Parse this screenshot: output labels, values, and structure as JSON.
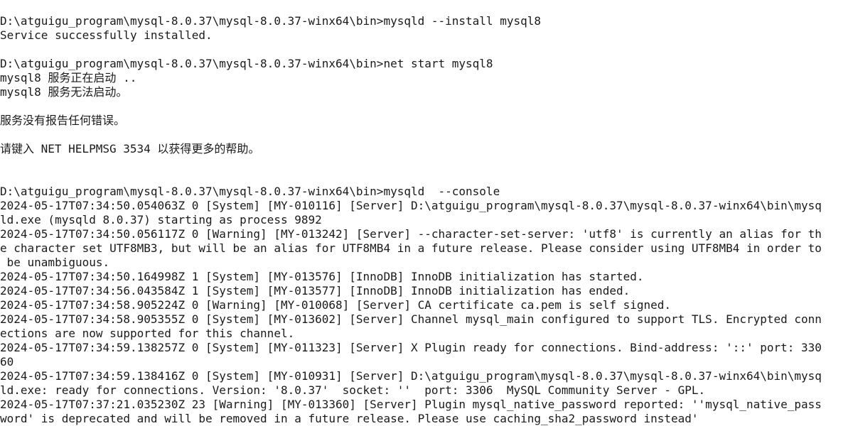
{
  "console": {
    "lines": [
      "D:\\atguigu_program\\mysql-8.0.37\\mysql-8.0.37-winx64\\bin>mysqld --install mysql8",
      "Service successfully installed.",
      "",
      "D:\\atguigu_program\\mysql-8.0.37\\mysql-8.0.37-winx64\\bin>net start mysql8",
      "mysql8 服务正在启动 ..",
      "mysql8 服务无法启动。",
      "",
      "服务没有报告任何错误。",
      "",
      "请键入 NET HELPMSG 3534 以获得更多的帮助。",
      "",
      "",
      "D:\\atguigu_program\\mysql-8.0.37\\mysql-8.0.37-winx64\\bin>mysqld  --console",
      "2024-05-17T07:34:50.054063Z 0 [System] [MY-010116] [Server] D:\\atguigu_program\\mysql-8.0.37\\mysql-8.0.37-winx64\\bin\\mysq",
      "ld.exe (mysqld 8.0.37) starting as process 9892",
      "2024-05-17T07:34:50.056117Z 0 [Warning] [MY-013242] [Server] --character-set-server: 'utf8' is currently an alias for th",
      "e character set UTF8MB3, but will be an alias for UTF8MB4 in a future release. Please consider using UTF8MB4 in order to",
      " be unambiguous.",
      "2024-05-17T07:34:50.164998Z 1 [System] [MY-013576] [InnoDB] InnoDB initialization has started.",
      "2024-05-17T07:34:56.043584Z 1 [System] [MY-013577] [InnoDB] InnoDB initialization has ended.",
      "2024-05-17T07:34:58.905224Z 0 [Warning] [MY-010068] [Server] CA certificate ca.pem is self signed.",
      "2024-05-17T07:34:58.905355Z 0 [System] [MY-013602] [Server] Channel mysql_main configured to support TLS. Encrypted conn",
      "ections are now supported for this channel.",
      "2024-05-17T07:34:59.138257Z 0 [System] [MY-011323] [Server] X Plugin ready for connections. Bind-address: '::' port: 330",
      "60",
      "2024-05-17T07:34:59.138416Z 0 [System] [MY-010931] [Server] D:\\atguigu_program\\mysql-8.0.37\\mysql-8.0.37-winx64\\bin\\mysq",
      "ld.exe: ready for connections. Version: '8.0.37'  socket: ''  port: 3306  MySQL Community Server - GPL.",
      "2024-05-17T07:37:21.035230Z 23 [Warning] [MY-013360] [Server] Plugin mysql_native_password reported: ''mysql_native_pass",
      "word' is deprecated and will be removed in a future release. Please use caching_sha2_password instead'"
    ]
  }
}
